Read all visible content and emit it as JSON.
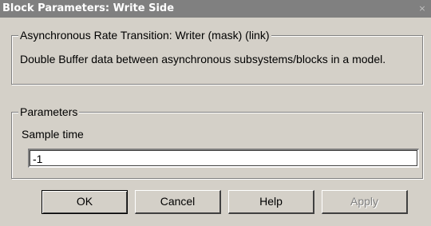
{
  "window": {
    "title": "Block Parameters: Write Side",
    "close_glyph": "×"
  },
  "mask_group": {
    "legend": "Asynchronous Rate Transition: Writer (mask) (link)",
    "description": "Double Buffer data between asynchronous subsystems/blocks in a model."
  },
  "parameters_group": {
    "legend": "Parameters",
    "sample_time_label": "Sample time",
    "sample_time_value": "-1"
  },
  "buttons": {
    "ok": "OK",
    "cancel": "Cancel",
    "help": "Help",
    "apply": "Apply"
  }
}
